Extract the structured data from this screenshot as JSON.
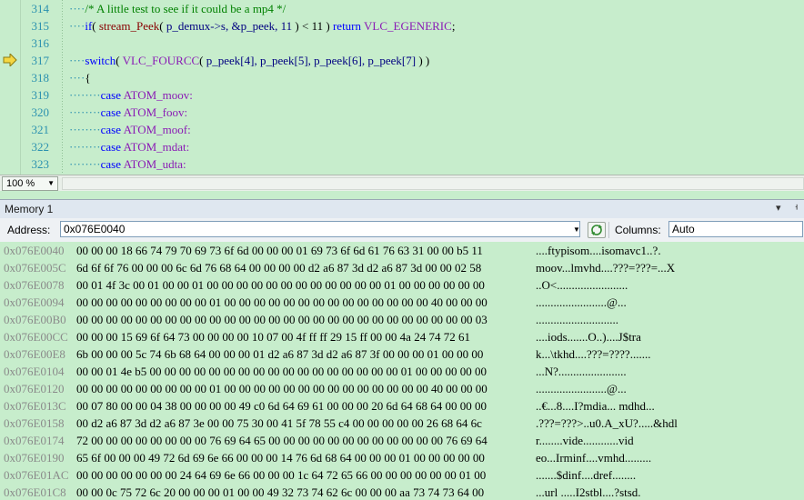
{
  "editor": {
    "lines": [
      {
        "num": "314"
      },
      {
        "num": "315"
      },
      {
        "num": "316"
      },
      {
        "num": "317"
      },
      {
        "num": "318"
      },
      {
        "num": "319"
      },
      {
        "num": "320"
      },
      {
        "num": "321"
      },
      {
        "num": "322"
      },
      {
        "num": "323"
      }
    ],
    "code": {
      "l314_comment": "/* A little test to see if it could be a mp4 */",
      "l315_if": "if",
      "l315_fn": "stream_Peek",
      "l315_args": "p_demux->s, &p_peek, 11 ",
      "l315_rest": " < 11 ",
      "l315_return": "return",
      "l315_macro": "VLC_EGENERIC",
      "l317_switch": "switch",
      "l317_macro": "VLC_FOURCC",
      "l317_args": " p_peek[4], p_peek[5], p_peek[6], p_peek[7] ",
      "l318_brace": "{",
      "case_kw": "case",
      "cases": [
        "ATOM_moov:",
        "ATOM_foov:",
        "ATOM_moof:",
        "ATOM_mdat:",
        "ATOM_udta:"
      ]
    },
    "zoom": "100 %",
    "current_line_icon": "current-statement-arrow-icon",
    "colors": {
      "background": "#c7edcc",
      "keyword": "#0000ff",
      "comment": "#008000",
      "macro": "#8a1bb5",
      "line_number": "#2b91af",
      "arrow": "#f5d742"
    }
  },
  "memory": {
    "title": "Memory 1",
    "address_label": "Address:",
    "address_value": "0x076E0040",
    "columns_label": "Columns:",
    "columns_value": "Auto",
    "rows": [
      {
        "addr": "0x076E0040",
        "hex": "00 00 00 18 66 74 79 70 69 73 6f 6d 00 00 00 01 69 73 6f 6d 61 76 63 31 00 00 b5 11",
        "ascii": "....ftypisom....isomavc1..?."
      },
      {
        "addr": "0x076E005C",
        "hex": "6d 6f 6f 76 00 00 00 6c 6d 76 68 64 00 00 00 00 d2 a6 87 3d d2 a6 87 3d 00 00 02 58",
        "ascii": "moov...lmvhd....???=???=...X"
      },
      {
        "addr": "0x076E0078",
        "hex": "00 01 4f 3c 00 01 00 00 01 00 00 00 00 00 00 00 00 00 00 00 00 01 00 00 00 00 00 00",
        "ascii": "..O<........................"
      },
      {
        "addr": "0x076E0094",
        "hex": "00 00 00 00 00 00 00 00 00 01 00 00 00 00 00 00 00 00 00 00 00 00 00 00 40 00 00 00",
        "ascii": "........................@..."
      },
      {
        "addr": "0x076E00B0",
        "hex": "00 00 00 00 00 00 00 00 00 00 00 00 00 00 00 00 00 00 00 00 00 00 00 00 00 00 00 03",
        "ascii": "............................"
      },
      {
        "addr": "0x076E00CC",
        "hex": "00 00 00 15 69 6f 64 73 00 00 00 00 10 07 00 4f ff ff 29 15 ff 00 00 4a 24 74 72 61",
        "ascii": "....iods.......O..)....J$tra"
      },
      {
        "addr": "0x076E00E8",
        "hex": "6b 00 00 00 5c 74 6b 68 64 00 00 00 01 d2 a6 87 3d d2 a6 87 3f 00 00 00 01 00 00 00",
        "ascii": "k...\\tkhd....???=????......."
      },
      {
        "addr": "0x076E0104",
        "hex": "00 00 01 4e b5 00 00 00 00 00 00 00 00 00 00 00 00 00 00 00 00 00 01 00 00 00 00 00",
        "ascii": "...N?......................."
      },
      {
        "addr": "0x076E0120",
        "hex": "00 00 00 00 00 00 00 00 00 01 00 00 00 00 00 00 00 00 00 00 00 00 00 00 40 00 00 00",
        "ascii": "........................@..."
      },
      {
        "addr": "0x076E013C",
        "hex": "00 07 80 00 00 04 38 00 00 00 00 49 c0 6d 64 69 61 00 00 00 20 6d 64 68 64 00 00 00",
        "ascii": "..€...8....I?mdia... mdhd..."
      },
      {
        "addr": "0x076E0158",
        "hex": "00 d2 a6 87 3d d2 a6 87 3e 00 00 75 30 00 41 5f 78 55 c4 00 00 00 00 00 26 68 64 6c",
        "ascii": ".???=???>..u0.A_xU?.....&hdl"
      },
      {
        "addr": "0x076E0174",
        "hex": "72 00 00 00 00 00 00 00 00 76 69 64 65 00 00 00 00 00 00 00 00 00 00 00 00 76 69 64",
        "ascii": "r........vide............vid"
      },
      {
        "addr": "0x076E0190",
        "hex": "65 6f 00 00 00 49 72 6d 69 6e 66 00 00 00 14 76 6d 68 64 00 00 00 01 00 00 00 00 00",
        "ascii": "eo...Irminf....vmhd........."
      },
      {
        "addr": "0x076E01AC",
        "hex": "00 00 00 00 00 00 00 24 64 69 6e 66 00 00 00 1c 64 72 65 66 00 00 00 00 00 00 01 00",
        "ascii": ".......$dinf....dref........"
      },
      {
        "addr": "0x076E01C8",
        "hex": "00 00 0c 75 72 6c 20 00 00 00 01 00 00 49 32 73 74 62 6c 00 00 00 aa 73 74 73 64 00",
        "ascii": "...url .....I2stbl....?stsd."
      }
    ]
  }
}
